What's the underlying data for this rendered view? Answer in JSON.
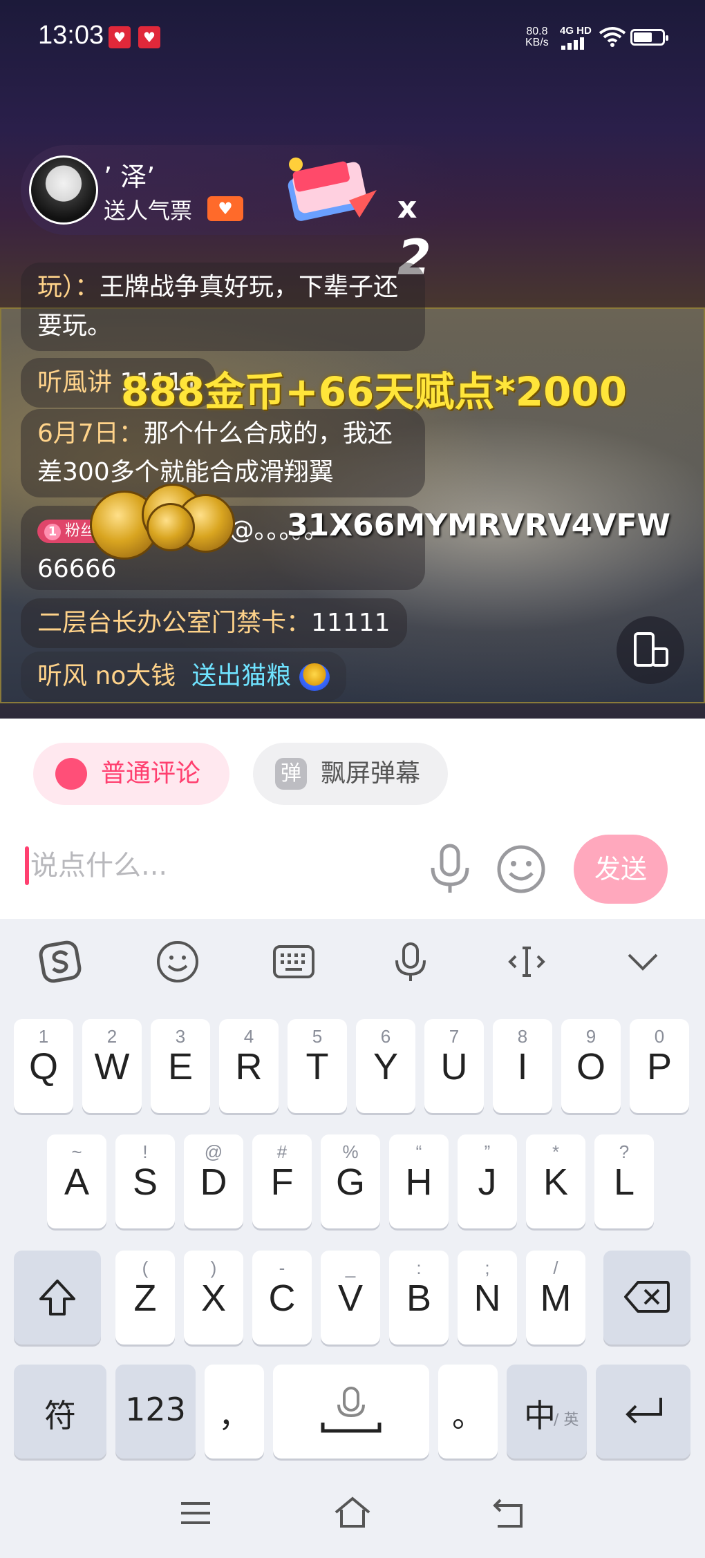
{
  "status_bar": {
    "time": "13:03",
    "net_speed": "80.8",
    "net_speed_unit": "KB/s",
    "network": "4G HD"
  },
  "gift_banner": {
    "username": "’ 泽’",
    "action": "送人气票",
    "count_prefix": "x",
    "count": "2"
  },
  "chat": {
    "messages": [
      {
        "user": "玩）：",
        "text": "王牌战争真好玩，下辈子还要玩。"
      },
      {
        "user": "听風讲",
        "text": "11111"
      },
      {
        "user": "6月7日：",
        "text": "那个什么合成的，我还差300多个就能合成滑翔翼"
      },
      {
        "badge_level": "1",
        "badge_label": "粉丝团",
        "text": "@。。。。。",
        "code": "31X66MYMRVRV4VFW",
        "text2": "66666"
      },
      {
        "user": "二层台长办公室门禁卡：",
        "text": "11111"
      },
      {
        "user": "听风 no大钱",
        "gift_text": "送出猫粮"
      }
    ],
    "promo_overlay": "888金币+66天赋点*2000"
  },
  "comment_panel": {
    "tab_normal": "普通评论",
    "tab_danmaku": "飘屏弹幕",
    "tab_danmaku_icon_char": "弹",
    "input_placeholder": "说点什么...",
    "send_label": "发送"
  },
  "keyboard": {
    "row1": [
      {
        "hint": "1",
        "key": "Q"
      },
      {
        "hint": "2",
        "key": "W"
      },
      {
        "hint": "3",
        "key": "E"
      },
      {
        "hint": "4",
        "key": "R"
      },
      {
        "hint": "5",
        "key": "T"
      },
      {
        "hint": "6",
        "key": "Y"
      },
      {
        "hint": "7",
        "key": "U"
      },
      {
        "hint": "8",
        "key": "I"
      },
      {
        "hint": "9",
        "key": "O"
      },
      {
        "hint": "0",
        "key": "P"
      }
    ],
    "row2": [
      {
        "hint": "~",
        "key": "A"
      },
      {
        "hint": "!",
        "key": "S"
      },
      {
        "hint": "@",
        "key": "D"
      },
      {
        "hint": "#",
        "key": "F"
      },
      {
        "hint": "%",
        "key": "G"
      },
      {
        "hint": "“",
        "key": "H"
      },
      {
        "hint": "”",
        "key": "J"
      },
      {
        "hint": "*",
        "key": "K"
      },
      {
        "hint": "?",
        "key": "L"
      }
    ],
    "row3": [
      {
        "hint": "(",
        "key": "Z"
      },
      {
        "hint": ")",
        "key": "X"
      },
      {
        "hint": "-",
        "key": "C"
      },
      {
        "hint": "_",
        "key": "V"
      },
      {
        "hint": ":",
        "key": "B"
      },
      {
        "hint": ";",
        "key": "N"
      },
      {
        "hint": "/",
        "key": "M"
      }
    ],
    "symbols_key": "符",
    "numbers_key": "123",
    "comma_key": "，",
    "period_key": "。",
    "lang_key": "中",
    "lang_key_sub": "/ 英"
  },
  "colors": {
    "accent_pink": "#ff3f6f",
    "send_pink": "#ffa8bd",
    "promo_yellow": "#ffe53a"
  }
}
